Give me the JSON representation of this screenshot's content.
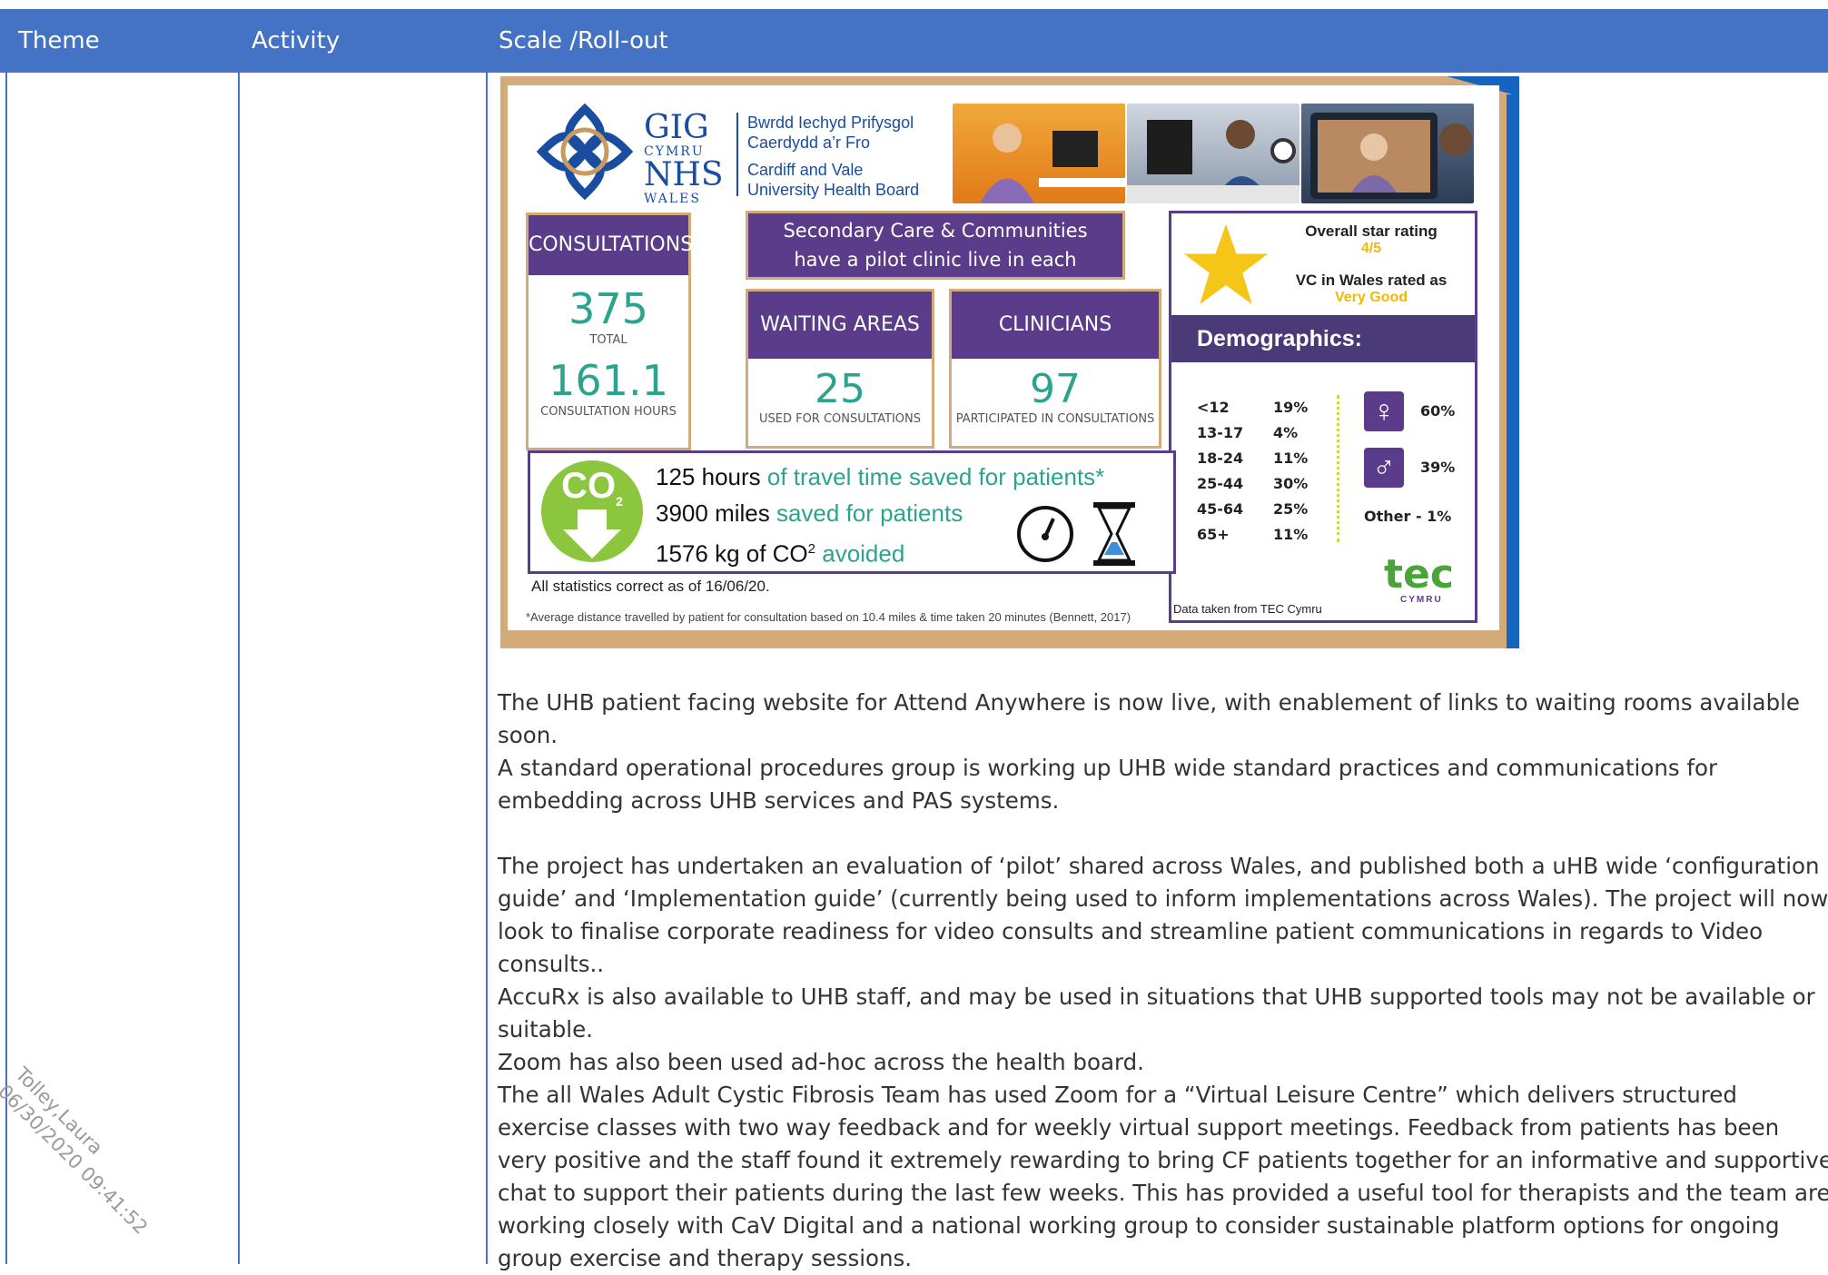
{
  "table": {
    "headers": {
      "theme": "Theme",
      "activity": "Activity",
      "scale": "Scale /Roll-out"
    }
  },
  "infographic": {
    "logo": {
      "gig": "GIG",
      "cymru": "CYMRU",
      "nhs": "NHS",
      "wales": "WALES"
    },
    "board_name": {
      "welsh_line1": "Bwrdd Iechyd Prifysgol",
      "welsh_line2": "Caerdydd a’r Fro",
      "english_line1": "Cardiff and Vale",
      "english_line2": "University Health Board"
    },
    "consultations": {
      "header": "CONSULTATIONS",
      "total_value": "375",
      "total_label": "TOTAL",
      "hours_value": "161.1",
      "hours_label": "CONSULTATION HOURS"
    },
    "secondary_care": "Secondary Care & Communities have a pilot clinic live in each clinical board.",
    "waiting_areas": {
      "header": "WAITING AREAS",
      "value": "25",
      "label": "USED FOR CONSULTATIONS"
    },
    "clinicians": {
      "header": "CLINICIANS",
      "value": "97",
      "label": "PARTICIPATED IN CONSULTATIONS"
    },
    "rating": {
      "label": "Overall star rating",
      "value": "4/5",
      "vc_label": "VC in Wales rated as",
      "vc_value": "Very Good"
    },
    "demographics": {
      "title": "Demographics:",
      "age_groups": [
        {
          "range": "<12",
          "pct": "19%"
        },
        {
          "range": "13-17",
          "pct": "4%"
        },
        {
          "range": "18-24",
          "pct": "11%"
        },
        {
          "range": "25-44",
          "pct": "30%"
        },
        {
          "range": "45-64",
          "pct": "25%"
        },
        {
          "range": "65+",
          "pct": "11%"
        }
      ],
      "female": "60%",
      "male": "39%",
      "other": "Other - 1%",
      "source": "Data taken from TEC Cymru"
    },
    "savings": {
      "co2_icon": "CO",
      "co2_sub": "2",
      "line1_bold": "125 hours",
      "line1_rest": "of travel time saved for patients*",
      "line2_bold": "3900 miles",
      "line2_rest": "saved for patients",
      "line3_bold": "1576 kg of CO",
      "line3_sup": "2",
      "line3_rest": "avoided"
    },
    "stats_note": "All statistics correct as of 16/06/20.",
    "footnote": "*Average distance travelled by patient for consultation based on 10.4 miles & time taken 20 minutes (Bennett, 2017)",
    "tec_logo": "tec",
    "tec_sub": "CYMRU",
    "colors": {
      "purple": "#5b3c8a",
      "teal": "#2aa48e",
      "tan": "#d3ab7b",
      "blue": "#1565c0",
      "gold": "#f5c518"
    }
  },
  "paragraphs": [
    "The UHB patient facing website for Attend Anywhere is now live, with enablement of links to waiting rooms available soon.",
    "A standard operational procedures group is working up UHB wide standard practices and communications for embedding across UHB services and PAS systems.",
    "The project has undertaken an evaluation of ‘pilot’ shared across Wales, and published both a uHB wide ‘configuration guide’ and ‘Implementation guide’ (currently being used to inform implementations across Wales). The project will now look to finalise corporate readiness for video consults and streamline patient communications in regards to Video consults..",
    "AccuRx is also available to UHB staff, and may be used in situations that UHB supported tools may not be available or suitable.",
    "Zoom has also been used ad-hoc across the health board.",
    "The all Wales Adult Cystic Fibrosis Team has used Zoom for a “Virtual Leisure Centre” which delivers structured exercise classes with two way feedback and for weekly virtual support meetings. Feedback from patients has been very positive and the staff found it extremely rewarding to bring CF patients together for an informative and supportive chat to support their patients during the last few weeks.  This has provided a useful tool for therapists and the team are working closely with CaV Digital and a national working group to consider sustainable platform options for ongoing group exercise and therapy sessions."
  ],
  "watermark": {
    "name": "Tolley,Laura",
    "timestamp": "06/30/2020 09:41:52"
  }
}
